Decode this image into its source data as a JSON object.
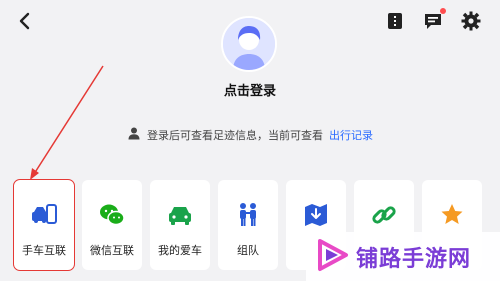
{
  "header": {
    "back_icon": "chevron-left-icon",
    "icons": [
      "book-icon",
      "message-icon",
      "gear-icon"
    ]
  },
  "profile": {
    "login_prompt": "点击登录"
  },
  "hint": {
    "text": "登录后可查看足迹信息，当前可查看",
    "link": "出行记录"
  },
  "tiles": [
    {
      "label": "手车互联",
      "icon": "car-phone-icon",
      "color": "#2b5bd6"
    },
    {
      "label": "微信互联",
      "icon": "wechat-icon",
      "color": "#1aad19"
    },
    {
      "label": "我的爱车",
      "icon": "car-icon",
      "color": "#1aa34a"
    },
    {
      "label": "组队",
      "icon": "team-icon",
      "color": "#2b5bd6"
    },
    {
      "label": "",
      "icon": "map-download-icon",
      "color": "#2b5bd6"
    },
    {
      "label": "",
      "icon": "link-icon",
      "color": "#1aa34a"
    },
    {
      "label": "",
      "icon": "star-icon",
      "color": "#f59a23"
    }
  ],
  "watermark": {
    "text": "铺路手游网"
  },
  "colors": {
    "accent": "#2b6bff",
    "highlight": "#e53935"
  }
}
